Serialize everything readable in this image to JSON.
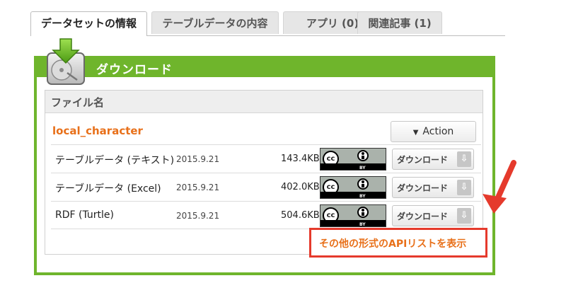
{
  "tabs": [
    {
      "label": "データセットの情報",
      "active": true
    },
    {
      "label": "テーブルデータの内容",
      "active": false
    },
    {
      "label": "アプリ (0)",
      "active": false
    },
    {
      "label": "関連記事 (1)",
      "active": false
    }
  ],
  "download_panel": {
    "title": "ダウンロード",
    "file_header": "ファイル名",
    "dataset_name": "local_character",
    "action_label": "Action",
    "rows": [
      {
        "format": "テーブルデータ (テキスト)",
        "date": "2015.9.21",
        "size": "143.4KB",
        "license_text": "BY",
        "download_label": "ダウンロード"
      },
      {
        "format": "テーブルデータ (Excel)",
        "date": "2015.9.21",
        "size": "402.0KB",
        "license_text": "BY",
        "download_label": "ダウンロード"
      },
      {
        "format": "RDF (Turtle)",
        "date": "2015.9.21",
        "size": "504.6KB",
        "license_text": "BY",
        "download_label": "ダウンロード"
      }
    ],
    "other_formats_label": "その他の形式のAPIリストを表示"
  },
  "icons": {
    "panel_icon": "hdd-download-icon",
    "license_icon": "cc-by-icon",
    "row_download_icon": "download-arrow-icon",
    "action_caret": "caret-down-icon",
    "annotation": "red-arrow-icon"
  },
  "colors": {
    "panel_green": "#6fb52c",
    "dataset_orange": "#e8701a",
    "highlight_red": "#e53a2c"
  }
}
